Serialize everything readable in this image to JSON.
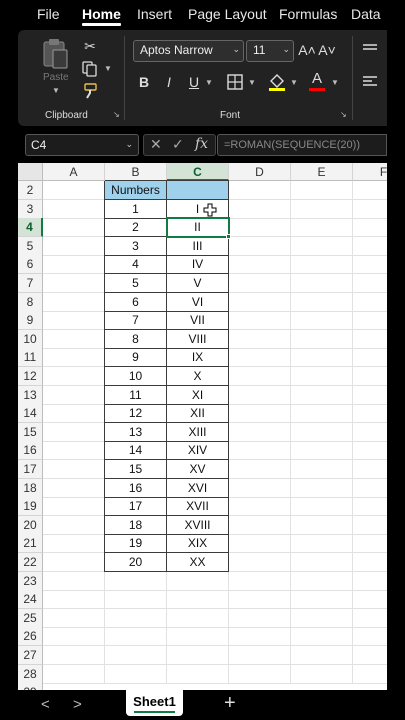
{
  "ribbon_tabs": [
    "File",
    "Home",
    "Insert",
    "Page Layout",
    "Formulas",
    "Data"
  ],
  "active_tab": "Home",
  "clipboard": {
    "paste_label": "Paste",
    "group_label": "Clipboard",
    "paste_icon": "clipboard-paste-icon",
    "cut_icon": "scissors-icon",
    "copy_icon": "copy-icon",
    "format_painter_icon": "paintbrush-icon"
  },
  "font": {
    "family": "Aptos Narrow",
    "size": "11",
    "group_label": "Font",
    "bold_label": "B",
    "italic_label": "I",
    "underline_label": "U",
    "grow_label": "A˄",
    "shrink_label": "A˅",
    "font_color_label": "A",
    "fill_color": "#ffff00",
    "font_color": "#ff0000"
  },
  "formula_bar": {
    "name_box": "C4",
    "cancel_glyph": "✕",
    "enter_glyph": "✓",
    "fx_label": "fx",
    "formula": "=ROMAN(SEQUENCE(20))"
  },
  "grid": {
    "columns": [
      "A",
      "B",
      "C",
      "D",
      "E",
      "F"
    ],
    "selected_column": "C",
    "rows": [
      2,
      3,
      4,
      5,
      6,
      7,
      8,
      9,
      10,
      11,
      12,
      13,
      14,
      15,
      16,
      17,
      18,
      19,
      20,
      21,
      22,
      23,
      24,
      25,
      26,
      27,
      28
    ],
    "last_row_partial": "29",
    "selected_row": 4,
    "active_cell": "C4",
    "table_headers": [
      "Numbers",
      ""
    ],
    "numbers": [
      "1",
      "2",
      "3",
      "4",
      "5",
      "6",
      "7",
      "8",
      "9",
      "10",
      "11",
      "12",
      "13",
      "14",
      "15",
      "16",
      "17",
      "18",
      "19",
      "20"
    ],
    "romans": [
      "I",
      "II",
      "III",
      "IV",
      "V",
      "VI",
      "VII",
      "VIII",
      "IX",
      "X",
      "XI",
      "XII",
      "XIII",
      "XIV",
      "XV",
      "XVI",
      "XVII",
      "XVIII",
      "XIX",
      "XX"
    ],
    "header_fill": "#9fd0ec",
    "accent": "#107c41"
  },
  "sheet_tabs": {
    "prev_glyph": "<",
    "next_glyph": ">",
    "active": "Sheet1",
    "add_glyph": "+"
  }
}
